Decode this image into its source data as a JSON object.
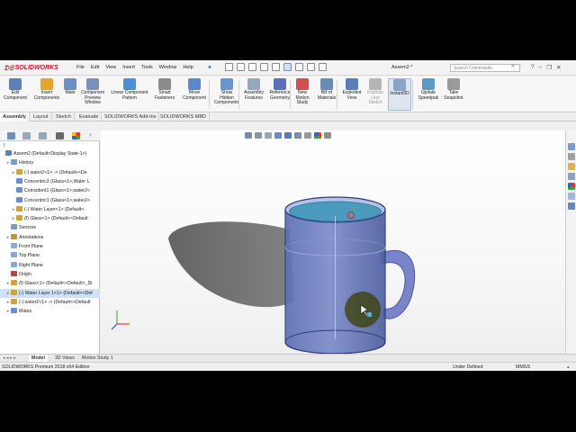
{
  "app": {
    "brand": "SOLIDWORKS",
    "document_title": "Assem2 *"
  },
  "menus": [
    "File",
    "Edit",
    "View",
    "Insert",
    "Tools",
    "Window",
    "Help"
  ],
  "search": {
    "placeholder": "Search Commands"
  },
  "toolbar": [
    {
      "label": "Edit\nComponent",
      "icon": "edit-component-icon"
    },
    {
      "label": "Insert\nComponents",
      "icon": "insert-components-icon"
    },
    {
      "label": "Mate",
      "icon": "mate-icon"
    },
    {
      "label": "Component\nPreview\nWindow",
      "icon": "component-preview-icon"
    },
    {
      "label": "Linear Component\nPattern",
      "icon": "linear-pattern-icon"
    },
    {
      "label": "Smart\nFasteners",
      "icon": "smart-fasteners-icon"
    },
    {
      "label": "Move\nComponent",
      "icon": "move-component-icon"
    },
    {
      "label": "Show\nHidden\nComponents",
      "icon": "show-hidden-icon"
    },
    {
      "label": "Assembly\nFeatures",
      "icon": "assembly-features-icon"
    },
    {
      "label": "Reference\nGeometry",
      "icon": "reference-geometry-icon"
    },
    {
      "label": "New\nMotion\nStudy",
      "icon": "motion-study-icon"
    },
    {
      "label": "Bill of\nMaterials",
      "icon": "bom-icon"
    },
    {
      "label": "Exploded\nView",
      "icon": "exploded-view-icon"
    },
    {
      "label": "Explode\nLine\nSketch",
      "icon": "explode-line-icon"
    },
    {
      "label": "Instant3D",
      "icon": "instant3d-icon"
    },
    {
      "label": "Update\nSpeedpak",
      "icon": "speedpak-icon"
    },
    {
      "label": "Take\nSnapshot",
      "icon": "snapshot-icon"
    }
  ],
  "tabs": [
    "Assembly",
    "Layout",
    "Sketch",
    "Evaluate",
    "SOLIDWORKS Add-Ins",
    "SOLIDWORKS MBD"
  ],
  "tree": [
    {
      "text": "Assem2  (Default<Display State-1>)",
      "indent": 0,
      "expand": "",
      "icon": "assembly-icon"
    },
    {
      "text": "History",
      "indent": 1,
      "expand": "▸",
      "icon": "history-icon"
    },
    {
      "text": "(-) water2<1> -> (Default<<De",
      "indent": 2,
      "expand": "▸",
      "icon": "part-icon"
    },
    {
      "text": "Concentric2 (Glass<1>,Water L",
      "indent": 2,
      "expand": "",
      "icon": "mate-icon"
    },
    {
      "text": "Coincident1 (Glass<1>,water2<",
      "indent": 2,
      "expand": "",
      "icon": "mate-icon"
    },
    {
      "text": "Concentric1 (Glass<1>,water2<",
      "indent": 2,
      "expand": "",
      "icon": "mate-icon"
    },
    {
      "text": "(-) Water Layer<1> (Default<",
      "indent": 2,
      "expand": "▸",
      "icon": "part-icon"
    },
    {
      "text": "(f) Glass<1> (Default<<Default",
      "indent": 2,
      "expand": "▸",
      "icon": "part-icon"
    },
    {
      "text": "Sensors",
      "indent": 1,
      "expand": "",
      "icon": "sensors-icon"
    },
    {
      "text": "Annotations",
      "indent": 1,
      "expand": "▸",
      "icon": "annotations-icon"
    },
    {
      "text": "Front Plane",
      "indent": 1,
      "expand": "",
      "icon": "plane-icon"
    },
    {
      "text": "Top Plane",
      "indent": 1,
      "expand": "",
      "icon": "plane-icon"
    },
    {
      "text": "Right Plane",
      "indent": 1,
      "expand": "",
      "icon": "plane-icon"
    },
    {
      "text": "Origin",
      "indent": 1,
      "expand": "",
      "icon": "origin-icon"
    },
    {
      "text": "(f) Glass<1> (Default<<Default>_Di",
      "indent": 1,
      "expand": "▸",
      "icon": "part-icon"
    },
    {
      "text": "(-) Water Layer 1<1> (Default<<Def",
      "indent": 1,
      "expand": "▸",
      "icon": "part-icon"
    },
    {
      "text": "(-) water2<1> -> (Default<<Default",
      "indent": 1,
      "expand": "▸",
      "icon": "part-icon"
    },
    {
      "text": "Mates",
      "indent": 1,
      "expand": "▸",
      "icon": "mates-folder-icon"
    }
  ],
  "tree_highlight_index": 15,
  "bottom_tabs": [
    "Model",
    "3D Views",
    "Motion Study 1"
  ],
  "status": {
    "product": "SOLIDWORKS Premium 2018 x64 Edition",
    "state": "Under Defined",
    "units": "MMGS"
  },
  "colors": {
    "accent": "#2a6fb8",
    "brand": "#c8102e",
    "glass": "#4a5fa8",
    "water": "#3d8fb0",
    "highlight": "#cfe1f6"
  }
}
